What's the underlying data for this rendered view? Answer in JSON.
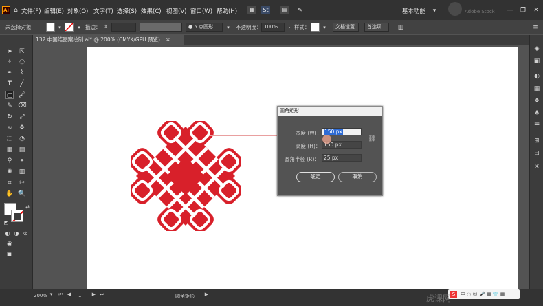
{
  "menubar": {
    "items": [
      "文件(F)",
      "编辑(E)",
      "对象(O)",
      "文字(T)",
      "选择(S)",
      "效果(C)",
      "视图(V)",
      "窗口(W)",
      "帮助(H)"
    ],
    "workspace": "基本功能",
    "user_watermark": "Adobe Stock"
  },
  "control_bar": {
    "selection": "未选择对象",
    "stroke_label": "描边：",
    "brush_label": "5 点圆形",
    "opacity_label": "不透明度：",
    "opacity_value": "100%",
    "style_label": "样式：",
    "doc_setup": "文档设置",
    "prefs": "首选项"
  },
  "document": {
    "tab_title": "132.中国结图案绘制.ai* @ 200% (CMYK/GPU 预览)"
  },
  "colors": {
    "knot_red": "#d8202a",
    "ui_dark": "#323232",
    "ui_mid": "#535353"
  },
  "dialog": {
    "title": "圆角矩形",
    "width_label": "宽度 (W)：",
    "width_value": "150 px",
    "height_label": "高度 (H)：",
    "height_value": "150 px",
    "radius_label": "圆角半径 (R)：",
    "radius_value": "25 px",
    "ok": "确定",
    "cancel": "取消"
  },
  "status": {
    "zoom": "200%",
    "page": "1",
    "tool_name": "圆角矩形",
    "watermark": "虎课网"
  }
}
